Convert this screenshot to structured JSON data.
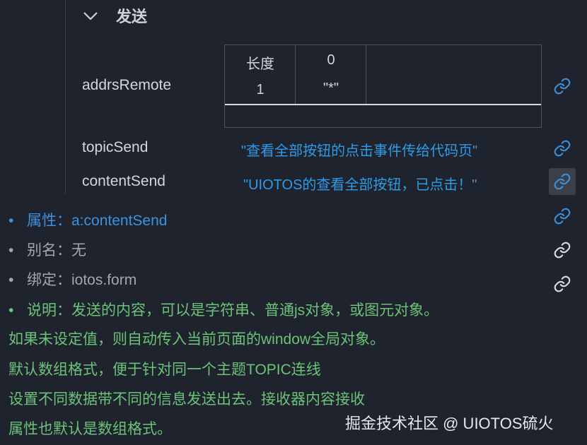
{
  "section": {
    "title": "发送",
    "chevron_icon": "chevron-down-icon"
  },
  "properties": {
    "addrsRemote": {
      "name": "addrsRemote",
      "table": {
        "header": [
          "长度",
          "0"
        ],
        "row": [
          "1",
          "\"*\""
        ]
      }
    },
    "topicSend": {
      "name": "topicSend",
      "value": "\"查看全部按钮的点击事件传给代码页\""
    },
    "contentSend": {
      "name": "contentSend",
      "value": "\"UIOTOS的查看全部按钮，已点击！\""
    }
  },
  "link_icon": "link-icon",
  "tooltip": {
    "attr": {
      "bullet": "•",
      "text": "属性：a:contentSend"
    },
    "alias": {
      "bullet": "•",
      "text": "别名：无"
    },
    "bind": {
      "bullet": "•",
      "text": "绑定：iotos.form"
    },
    "desc": [
      {
        "bullet": "•",
        "text": "说明：发送的内容，可以是字符串、普通js对象，或图元对象。"
      },
      {
        "text": "如果未设定值，则自动传入当前页面的window全局对象。"
      },
      {
        "text": "默认数组格式，便于针对同一个主题TOPIC连线"
      },
      {
        "text": "设置不同数据带不同的信息发送出去。接收器内容接收"
      },
      {
        "text": "属性也默认是数组格式。"
      }
    ]
  },
  "watermark": "掘金技术社区 @ UIOTOS硫火",
  "colors": {
    "background": "#1e232d",
    "string_value": "#2f9be6",
    "link_blue": "#3a8fd9",
    "link_gray": "#d8dadd",
    "tooltip_attr": "#3d92dd",
    "tooltip_gray": "#a2a6ad",
    "tooltip_desc": "#6cc278"
  }
}
